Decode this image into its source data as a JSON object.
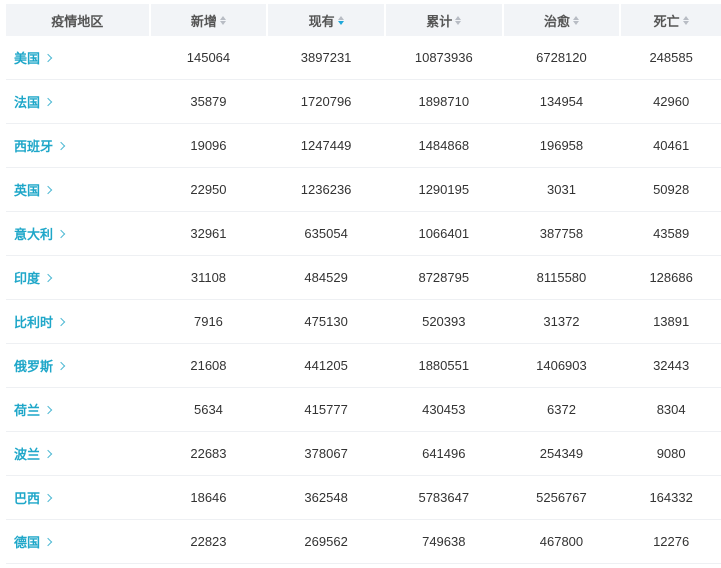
{
  "table": {
    "headers": {
      "region": "疫情地区",
      "new": "新增",
      "current": "现有",
      "total": "累计",
      "cured": "治愈",
      "deaths": "死亡"
    },
    "rows": [
      {
        "region": "美国",
        "new": "145064",
        "current": "3897231",
        "total": "10873936",
        "cured": "6728120",
        "deaths": "248585"
      },
      {
        "region": "法国",
        "new": "35879",
        "current": "1720796",
        "total": "1898710",
        "cured": "134954",
        "deaths": "42960"
      },
      {
        "region": "西班牙",
        "new": "19096",
        "current": "1247449",
        "total": "1484868",
        "cured": "196958",
        "deaths": "40461"
      },
      {
        "region": "英国",
        "new": "22950",
        "current": "1236236",
        "total": "1290195",
        "cured": "3031",
        "deaths": "50928"
      },
      {
        "region": "意大利",
        "new": "32961",
        "current": "635054",
        "total": "1066401",
        "cured": "387758",
        "deaths": "43589"
      },
      {
        "region": "印度",
        "new": "31108",
        "current": "484529",
        "total": "8728795",
        "cured": "8115580",
        "deaths": "128686"
      },
      {
        "region": "比利时",
        "new": "7916",
        "current": "475130",
        "total": "520393",
        "cured": "31372",
        "deaths": "13891"
      },
      {
        "region": "俄罗斯",
        "new": "21608",
        "current": "441205",
        "total": "1880551",
        "cured": "1406903",
        "deaths": "32443"
      },
      {
        "region": "荷兰",
        "new": "5634",
        "current": "415777",
        "total": "430453",
        "cured": "6372",
        "deaths": "8304"
      },
      {
        "region": "波兰",
        "new": "22683",
        "current": "378067",
        "total": "641496",
        "cured": "254349",
        "deaths": "9080"
      },
      {
        "region": "巴西",
        "new": "18646",
        "current": "362548",
        "total": "5783647",
        "cured": "5256767",
        "deaths": "164332"
      },
      {
        "region": "德国",
        "new": "22823",
        "current": "269562",
        "total": "749638",
        "cured": "467800",
        "deaths": "12276"
      }
    ]
  },
  "colors": {
    "accent": "#1fa7c9",
    "header_bg": "#f2f4f7",
    "sort_active": "#1fa7d9"
  },
  "icons": {
    "sort": "sort-arrows-icon",
    "chevron": "chevron-right-icon"
  }
}
